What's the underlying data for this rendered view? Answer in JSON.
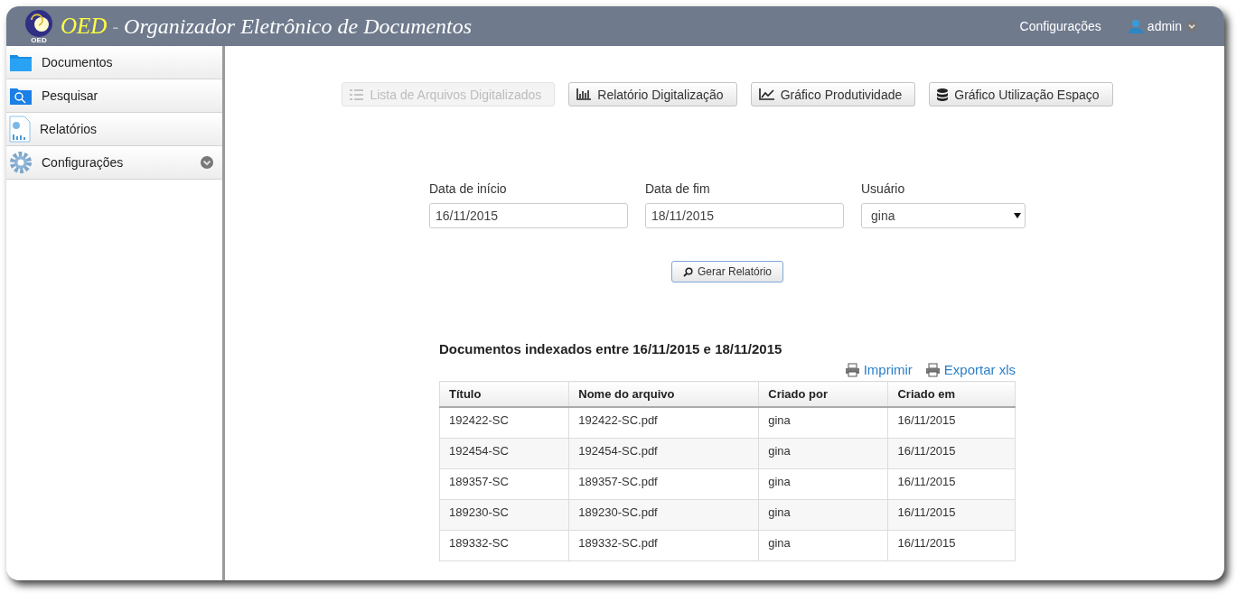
{
  "header": {
    "logo_text": "OED",
    "brand": "OED",
    "separator": "-",
    "title": "Organizador Eletrônico de Documentos",
    "links": [
      {
        "label": "Configurações",
        "kind": "link"
      },
      {
        "label": "admin",
        "kind": "user"
      }
    ]
  },
  "sidebar": {
    "items": [
      {
        "label": "Documentos",
        "kind": "folder",
        "expandable": false
      },
      {
        "label": "Pesquisar",
        "kind": "search-folder",
        "expandable": false
      },
      {
        "label": "Relatórios",
        "kind": "report",
        "expandable": false
      },
      {
        "label": "Configurações",
        "kind": "gear",
        "expandable": true
      }
    ]
  },
  "report_buttons": [
    {
      "label": "Lista de Arquivos Digitalizados",
      "kind": "list",
      "disabled": true
    },
    {
      "label": "Relatório Digitalização",
      "kind": "bars",
      "disabled": false
    },
    {
      "label": "Gráfico Produtividade",
      "kind": "line",
      "disabled": false
    },
    {
      "label": "Gráfico Utilização Espaço",
      "kind": "database",
      "disabled": false
    }
  ],
  "form": {
    "fields": [
      {
        "label": "Data de início",
        "value": "16/11/2015",
        "kind": "text"
      },
      {
        "label": "Data de fim",
        "value": "18/11/2015",
        "kind": "text"
      },
      {
        "label": "Usuário",
        "value": "gina",
        "kind": "select"
      }
    ],
    "submit": "Gerar Relatório"
  },
  "results": {
    "heading": "Documentos indexados entre 16/11/2015 e 18/11/2015",
    "actions": [
      "Imprimir",
      "Exportar xls"
    ],
    "columns": [
      "Título",
      "Nome do arquivo",
      "Criado por",
      "Criado em"
    ],
    "rows": [
      [
        "192422-SC",
        "192422-SC.pdf",
        "gina",
        "16/11/2015"
      ],
      [
        "192454-SC",
        "192454-SC.pdf",
        "gina",
        "16/11/2015"
      ],
      [
        "189357-SC",
        "189357-SC.pdf",
        "gina",
        "16/11/2015"
      ],
      [
        "189230-SC",
        "189230-SC.pdf",
        "gina",
        "16/11/2015"
      ],
      [
        "189332-SC",
        "189332-SC.pdf",
        "gina",
        "16/11/2015"
      ]
    ]
  }
}
